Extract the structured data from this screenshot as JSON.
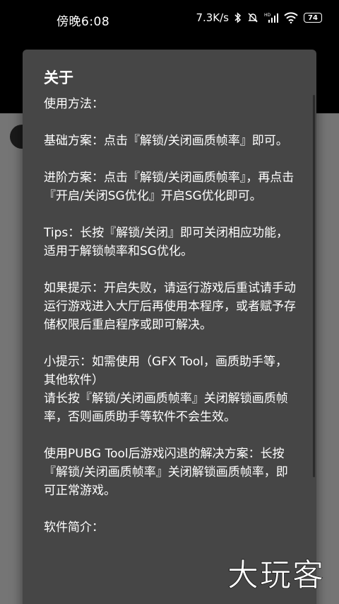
{
  "status_bar": {
    "time": "傍晚6:08",
    "net_speed": "7.3K/s",
    "battery": "74",
    "icons": [
      "bluetooth-icon",
      "mute-icon",
      "hd-signal-icon",
      "wifi-icon",
      "battery-icon"
    ]
  },
  "dialog": {
    "title": "关于",
    "body": "使用方法：\n\n基础方案：点击『解锁/关闭画质帧率』即可。\n\n进阶方案：点击『解锁/关闭画质帧率』，再点击『开启/关闭SG优化』开启SG优化即可。\n\nTips：长按『解锁/关闭』即可关闭相应功能，适用于解锁帧率和SG优化。\n\n如果提示：开启失败，请运行游戏后重试请手动运行游戏进入大厅后再使用本程序，或者赋予存储权限后重启程序或即可解决。\n\n小提示：如需使用（GFX Tool，画质助手等，其他软件）\n请长按『解锁/关闭画质帧率』关闭解锁画质帧率，否则画质助手等软件不会生效。\n\n使用PUBG Tool后游戏闪退的解决方案：长按『解锁/关闭画质帧率』关闭解锁画质帧率，即可正常游戏。\n\n软件简介："
  },
  "watermark": {
    "text": "大玩客"
  },
  "colors": {
    "dialog_bg": "#464646",
    "content_bg": "#757575",
    "text": "#ffffff"
  }
}
